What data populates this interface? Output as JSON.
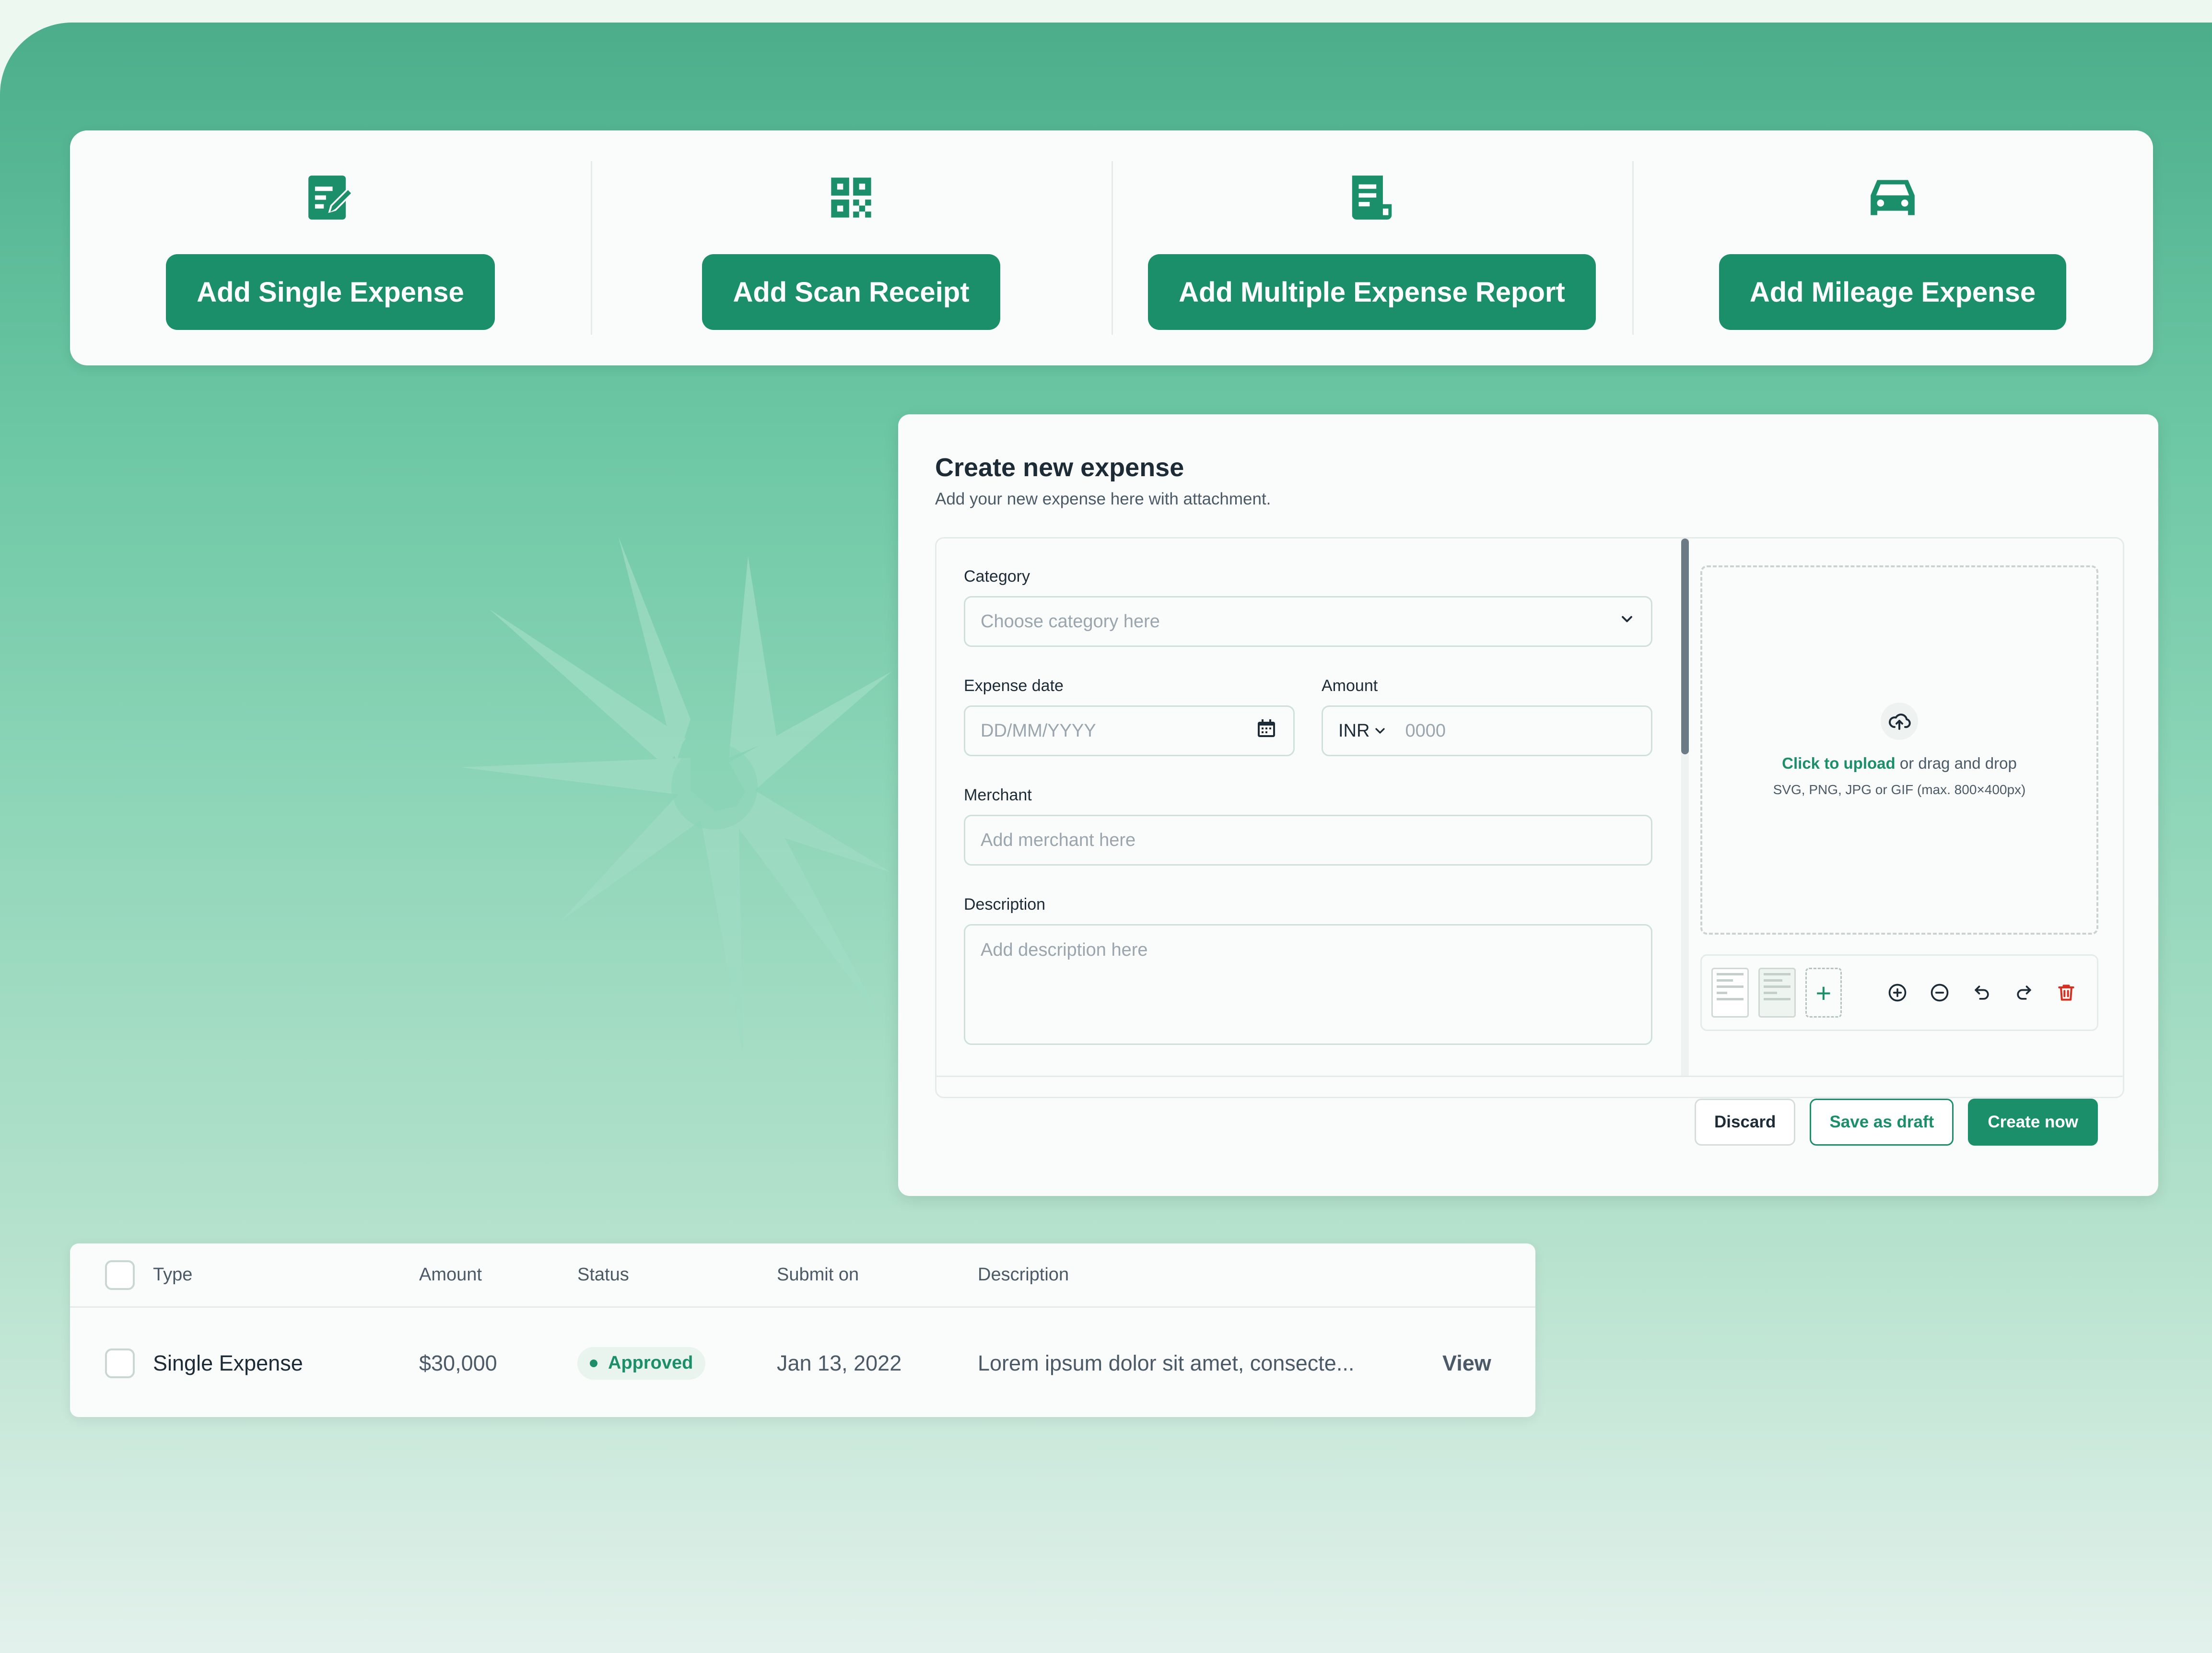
{
  "colors": {
    "brand": "#1b8f6a",
    "danger": "#d92d20"
  },
  "actions": [
    {
      "label": "Add Single Expense",
      "icon": "edit-document-icon"
    },
    {
      "label": "Add Scan Receipt",
      "icon": "qr-code-icon"
    },
    {
      "label": "Add Multiple Expense Report",
      "icon": "receipt-icon"
    },
    {
      "label": "Add Mileage Expense",
      "icon": "car-icon"
    }
  ],
  "modal": {
    "title": "Create new expense",
    "subtitle": "Add your new expense here with attachment.",
    "category": {
      "label": "Category",
      "placeholder": "Choose category here"
    },
    "expense_date": {
      "label": "Expense date",
      "placeholder": "DD/MM/YYYY"
    },
    "amount": {
      "label": "Amount",
      "currency": "INR",
      "placeholder": "0000"
    },
    "merchant": {
      "label": "Merchant",
      "placeholder": "Add merchant here"
    },
    "description": {
      "label": "Description",
      "placeholder": "Add description here"
    },
    "upload": {
      "link": "Click to upload",
      "text": " or drag and drop",
      "hint": "SVG, PNG, JPG or GIF (max. 800×400px)"
    },
    "add_attachment": "+",
    "buttons": {
      "discard": "Discard",
      "draft": "Save as draft",
      "create": "Create now"
    }
  },
  "table": {
    "headers": {
      "type": "Type",
      "amount": "Amount",
      "status": "Status",
      "submit": "Submit on",
      "description": "Description"
    },
    "rows": [
      {
        "type": "Single Expense",
        "amount": "$30,000",
        "status": "Approved",
        "submit": "Jan 13, 2022",
        "description": "Lorem ipsum dolor sit amet, consecte...",
        "action": "View"
      }
    ]
  }
}
